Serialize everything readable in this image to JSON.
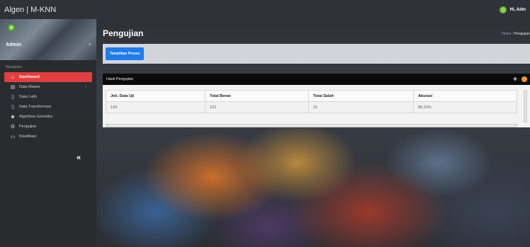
{
  "app": {
    "title": "Algen | M-KNN"
  },
  "user": {
    "greeting": "Hi, Adm"
  },
  "sidebar": {
    "profile_name": "Admin",
    "nav_heading": "Navigation",
    "items": [
      {
        "label": "Dashboard",
        "icon": "home-icon"
      },
      {
        "label": "Data Master",
        "icon": "table-icon"
      },
      {
        "label": "Data Latih",
        "icon": "file-icon"
      },
      {
        "label": "Data Transformasi",
        "icon": "file-icon"
      },
      {
        "label": "Algoritma Genetika",
        "icon": "users-icon"
      },
      {
        "label": "Pengujian",
        "icon": "gears-icon"
      },
      {
        "label": "Klasifikasi",
        "icon": "monitor-icon"
      }
    ],
    "collapse_glyph": "«"
  },
  "page": {
    "title": "Pengujian",
    "breadcrumb_home": "Home",
    "breadcrumb_sep": "/",
    "breadcrumb_current": "Pengujian",
    "action_button": "Tampilkan Proses"
  },
  "result_card": {
    "title": "Hasil Pengujian",
    "columns": [
      "Jml. Data Uji",
      "Total Benar",
      "Total Salah",
      "Akurasi"
    ],
    "rows": [
      [
        "143",
        "122",
        "21",
        "85.31%"
      ]
    ]
  },
  "colors": {
    "active_nav": "#e43f3f",
    "primary_button": "#1e7bf0",
    "card_header": "#0b0b0c",
    "tool_dot": "#f59a1b"
  }
}
